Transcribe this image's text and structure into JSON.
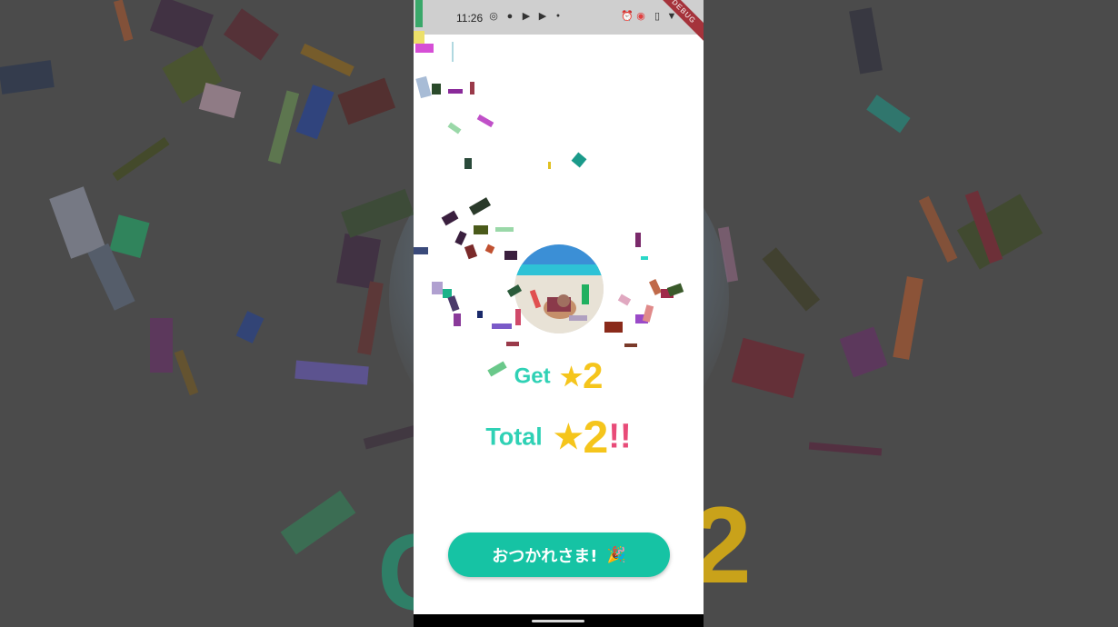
{
  "status_bar": {
    "time": "11:26",
    "left_icons": [
      "target-icon",
      "camera-icon",
      "youtube-icon",
      "youtube-icon",
      "dot-icon"
    ],
    "right_icons": [
      "alarm-icon",
      "record-icon",
      "vibrate-icon",
      "wifi-icon",
      "battery-icon"
    ],
    "debug_banner": "DEBUG"
  },
  "result": {
    "get_label": "Get",
    "star_symbol": "★",
    "get_count": "2",
    "total_label": "Total",
    "total_count": "2",
    "total_suffix": "!!"
  },
  "done_button": {
    "label": "おつかれさま!",
    "icon": "party-popper-icon",
    "icon_glyph": "🎉"
  },
  "colors": {
    "accent": "#16c3a4",
    "label_teal": "#2fd1b5",
    "star_gold": "#f5c51c",
    "exclaim_pink": "#e84b78",
    "backdrop": "#4b4b4b"
  }
}
